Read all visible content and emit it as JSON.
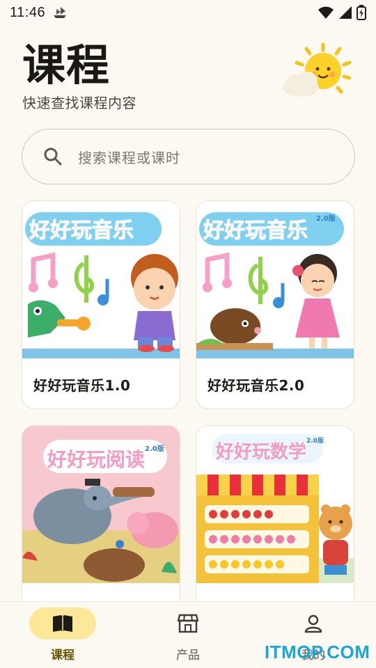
{
  "status_bar": {
    "time": "11:46"
  },
  "header": {
    "title": "课程",
    "subtitle": "快速查找课程内容"
  },
  "search": {
    "placeholder": "搜索课程或课时"
  },
  "courses": [
    {
      "name": "好好玩音乐1.0",
      "banner": "好好玩音乐"
    },
    {
      "name": "好好玩音乐2.0",
      "banner": "好好玩音乐",
      "badge": "2.0版"
    },
    {
      "name": "",
      "banner": "好好玩阅读",
      "badge": "2.0版"
    },
    {
      "name": "",
      "banner": "好好玩数学",
      "badge": "2.0版"
    }
  ],
  "nav": {
    "items": [
      {
        "label": "课程",
        "icon": "book-icon",
        "active": true
      },
      {
        "label": "产品",
        "icon": "store-icon",
        "active": false
      },
      {
        "label": "我的",
        "icon": "person-icon",
        "active": false
      }
    ]
  },
  "watermark": "ITMOP.COM",
  "colors": {
    "accent": "#fde89a",
    "accent_text": "#6a5300",
    "background": "#fbf9f2",
    "watermark": "#1aa6d6"
  }
}
